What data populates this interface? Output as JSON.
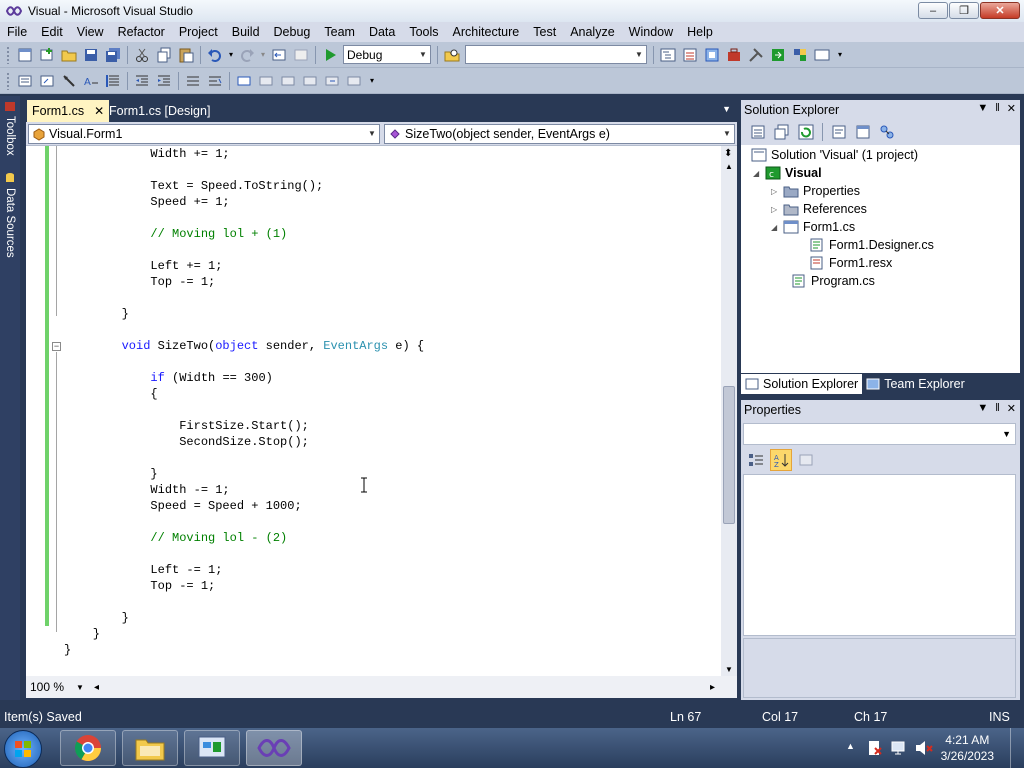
{
  "window": {
    "title": "Visual - Microsoft Visual Studio"
  },
  "menu": [
    "File",
    "Edit",
    "View",
    "Refactor",
    "Project",
    "Build",
    "Debug",
    "Team",
    "Data",
    "Tools",
    "Architecture",
    "Test",
    "Analyze",
    "Window",
    "Help"
  ],
  "toolbar": {
    "config_value": "Debug",
    "platform_value": ""
  },
  "left_dock": {
    "toolbox": "Toolbox",
    "data_sources": "Data Sources"
  },
  "editor": {
    "tabs": [
      {
        "label": "Form1.cs",
        "active": true
      },
      {
        "label": "Form1.cs [Design]",
        "active": false
      }
    ],
    "nav_class": "Visual.Form1",
    "nav_member": "SizeTwo(object sender, EventArgs e)",
    "zoom": "100 %",
    "code": [
      {
        "line": "            Width += 1;"
      },
      {
        "line": ""
      },
      {
        "line": "            Text = Speed.ToString();"
      },
      {
        "line": "            Speed += 1;"
      },
      {
        "line": ""
      },
      {
        "line": "            // Moving lol + (1)"
      },
      {
        "line": ""
      },
      {
        "line": "            Left += 1;"
      },
      {
        "line": "            Top -= 1;"
      },
      {
        "line": ""
      },
      {
        "line": "        }"
      },
      {
        "line": ""
      },
      {
        "line": "        void SizeTwo(object sender, EventArgs e) {"
      },
      {
        "line": ""
      },
      {
        "line": "            if (Width == 300)"
      },
      {
        "line": "            {"
      },
      {
        "line": ""
      },
      {
        "line": "                FirstSize.Start();"
      },
      {
        "line": "                SecondSize.Stop();"
      },
      {
        "line": ""
      },
      {
        "line": "            }"
      },
      {
        "line": "            Width -= 1;"
      },
      {
        "line": "            Speed = Speed + 1000;"
      },
      {
        "line": ""
      },
      {
        "line": "            // Moving lol - (2)"
      },
      {
        "line": ""
      },
      {
        "line": "            Left -= 1;"
      },
      {
        "line": "            Top -= 1;"
      },
      {
        "line": ""
      },
      {
        "line": "        }"
      },
      {
        "line": "    }"
      },
      {
        "line": "}"
      }
    ]
  },
  "solution_explorer": {
    "title": "Solution Explorer",
    "tree": [
      {
        "label": "Solution 'Visual' (1 project)"
      },
      {
        "label": "Visual"
      },
      {
        "label": "Properties"
      },
      {
        "label": "References"
      },
      {
        "label": "Form1.cs"
      },
      {
        "label": "Form1.Designer.cs"
      },
      {
        "label": "Form1.resx"
      },
      {
        "label": "Program.cs"
      }
    ],
    "bottom_tabs": [
      "Solution Explorer",
      "Team Explorer"
    ]
  },
  "properties": {
    "title": "Properties"
  },
  "status": {
    "message": "Item(s) Saved",
    "ln": "Ln 67",
    "col": "Col 17",
    "ch": "Ch 17",
    "mode": "INS"
  },
  "taskbar": {
    "time": "4:21 AM",
    "date": "3/26/2023"
  },
  "colors": {
    "accent": "#293955",
    "active_tab": "#fff4c2",
    "keyword": "#1a1aff",
    "comment": "#008000",
    "type": "#2b91af",
    "change_bar": "#6fd26a"
  }
}
